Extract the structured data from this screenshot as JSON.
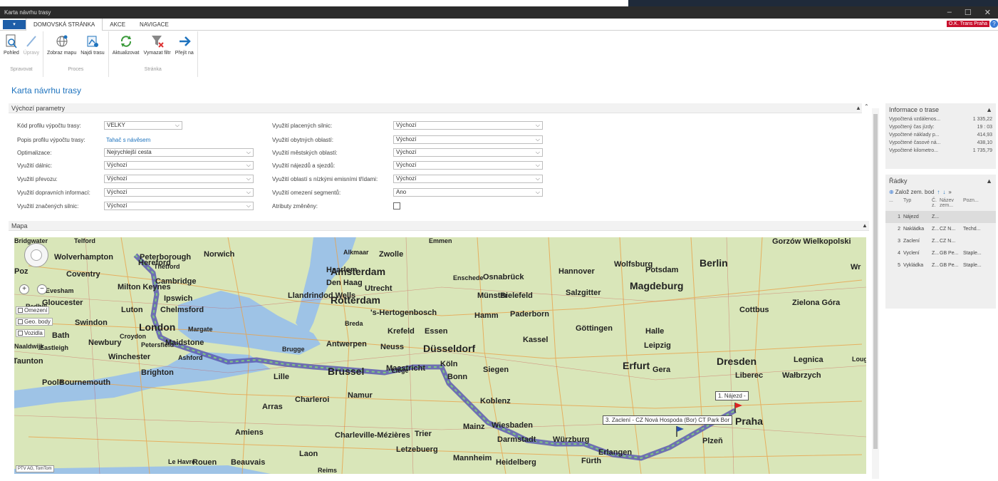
{
  "window": {
    "title": "Karta návrhu trasy",
    "minimize_icon": "minimize-icon",
    "maximize_glyph": "☐",
    "close_glyph": "✕"
  },
  "tabs": {
    "menu_glyph": "▾",
    "items": [
      "DOMOVSKÁ STRÁNKA",
      "AKCE",
      "NAVIGACE"
    ],
    "active": "DOMOVSKÁ STRÁNKA"
  },
  "company": "O.K. Trans Praha",
  "help_glyph": "?",
  "ribbon": {
    "groups": [
      {
        "label": "Spravovat",
        "buttons": [
          {
            "label": "Pohled",
            "icon": "view-icon"
          },
          {
            "label": "Úpravy",
            "icon": "edit-icon",
            "disabled": true
          }
        ]
      },
      {
        "label": "Proces",
        "buttons": [
          {
            "label": "Zobraz mapu",
            "icon": "globe-icon"
          },
          {
            "label": "Najdi trasu",
            "icon": "route-icon"
          }
        ]
      },
      {
        "label": "Stránka",
        "buttons": [
          {
            "label": "Aktualizovat",
            "icon": "refresh-icon"
          },
          {
            "label": "Vymazat filtr",
            "icon": "clear-filter-icon"
          },
          {
            "label": "Přejít na",
            "icon": "arrow-right-icon"
          }
        ]
      }
    ]
  },
  "page_title": "Karta návrhu trasy",
  "params": {
    "title": "Výchozí parametry",
    "left": [
      {
        "label": "Kód profilu výpočtu trasy:",
        "value": "VELKY",
        "type": "select"
      },
      {
        "label": "Popis profilu výpočtu trasy:",
        "value": "Tahač s návěsem",
        "type": "link"
      },
      {
        "label": "Optimalizace:",
        "value": "Nejrychlejší cesta",
        "type": "select"
      },
      {
        "label": "Využití dálnic:",
        "value": "Výchozí",
        "type": "select"
      },
      {
        "label": "Využití převozu:",
        "value": "Výchozí",
        "type": "select"
      },
      {
        "label": "Využití dopravních informací:",
        "value": "Výchozí",
        "type": "select"
      },
      {
        "label": "Využití značených silnic:",
        "value": "Výchozí",
        "type": "select"
      }
    ],
    "right": [
      {
        "label": "Využití placených silnic:",
        "value": "Výchozí",
        "type": "select"
      },
      {
        "label": "Využití obytných oblastí:",
        "value": "Výchozí",
        "type": "select"
      },
      {
        "label": "Využití městských oblastí:",
        "value": "Výchozí",
        "type": "select"
      },
      {
        "label": "Využití nájezdů a sjezdů:",
        "value": "Výchozí",
        "type": "select"
      },
      {
        "label": "Využití oblastí s nízkými emisními třídami:",
        "value": "Výchozí",
        "type": "select"
      },
      {
        "label": "Využití omezení segmentů:",
        "value": "Ano",
        "type": "select"
      },
      {
        "label": "Atributy změněny:",
        "value": "",
        "type": "checkbox"
      }
    ]
  },
  "map": {
    "title": "Mapa",
    "layers": [
      "Omezení",
      "Geo. body",
      "Vozidla"
    ],
    "copyright": "PTV AG, TomTom",
    "callouts": [
      "1. Nájezd -",
      "3. Zaclení - CZ Nová Hospoda (Bor) CT Park Bor"
    ],
    "cities": [
      {
        "n": "Wolverhampton",
        "s": "m"
      },
      {
        "n": "Peterborough",
        "s": "m"
      },
      {
        "n": "Norwich",
        "s": "m"
      },
      {
        "n": "Coventry",
        "s": "m"
      },
      {
        "n": "Cambridge",
        "s": "m"
      },
      {
        "n": "Milton Keynes",
        "s": "m"
      },
      {
        "n": "Ipswich",
        "s": "m"
      },
      {
        "n": "Gloucester",
        "s": "m"
      },
      {
        "n": "Luton",
        "s": "m"
      },
      {
        "n": "Chelmsford",
        "s": "m"
      },
      {
        "n": "Swindon",
        "s": "m"
      },
      {
        "n": "London",
        "s": "l"
      },
      {
        "n": "Maidstone",
        "s": "m"
      },
      {
        "n": "Newbury",
        "s": "m"
      },
      {
        "n": "Bath",
        "s": "m"
      },
      {
        "n": "Winchester",
        "s": "m"
      },
      {
        "n": "Taunton",
        "s": "m"
      },
      {
        "n": "Brighton",
        "s": "m"
      },
      {
        "n": "Poole",
        "s": "m"
      },
      {
        "n": "Bournemouth",
        "s": "m"
      },
      {
        "n": "Zwolle",
        "s": "m"
      },
      {
        "n": "Amsterdam",
        "s": "l"
      },
      {
        "n": "Haarlem",
        "s": "m"
      },
      {
        "n": "Den Haag",
        "s": "m"
      },
      {
        "n": "Utrecht",
        "s": "m"
      },
      {
        "n": "Rotterdam",
        "s": "l"
      },
      {
        "n": "'s-Hertogenbosch",
        "s": "m"
      },
      {
        "n": "Krefeld",
        "s": "m"
      },
      {
        "n": "Essen",
        "s": "m"
      },
      {
        "n": "Antwerpen",
        "s": "m"
      },
      {
        "n": "Neuss",
        "s": "m"
      },
      {
        "n": "Düsseldorf",
        "s": "l"
      },
      {
        "n": "Brussel",
        "s": "l"
      },
      {
        "n": "Köln",
        "s": "m"
      },
      {
        "n": "Bonn",
        "s": "m"
      },
      {
        "n": "Lille",
        "s": "m"
      },
      {
        "n": "Namur",
        "s": "m"
      },
      {
        "n": "Charleroi",
        "s": "m"
      },
      {
        "n": "Arras",
        "s": "m"
      },
      {
        "n": "Amiens",
        "s": "m"
      },
      {
        "n": "Charleville-Mézières",
        "s": "m"
      },
      {
        "n": "Rouen",
        "s": "m"
      },
      {
        "n": "Beauvais",
        "s": "m"
      },
      {
        "n": "Laon",
        "s": "m"
      },
      {
        "n": "Letzebuerg",
        "s": "m"
      },
      {
        "n": "Trier",
        "s": "m"
      },
      {
        "n": "Koblenz",
        "s": "m"
      },
      {
        "n": "Wiesbaden",
        "s": "m"
      },
      {
        "n": "Mainz",
        "s": "m"
      },
      {
        "n": "Darmstadt",
        "s": "m"
      },
      {
        "n": "Mannheim",
        "s": "m"
      },
      {
        "n": "Heidelberg",
        "s": "m"
      },
      {
        "n": "Würzburg",
        "s": "m"
      },
      {
        "n": "Erlangen",
        "s": "m"
      },
      {
        "n": "Fürth",
        "s": "m"
      },
      {
        "n": "Siegen",
        "s": "m"
      },
      {
        "n": "Osnabrück",
        "s": "m"
      },
      {
        "n": "Münster",
        "s": "m"
      },
      {
        "n": "Bielefeld",
        "s": "m"
      },
      {
        "n": "Hamm",
        "s": "m"
      },
      {
        "n": "Paderborn",
        "s": "m"
      },
      {
        "n": "Kassel",
        "s": "m"
      },
      {
        "n": "Göttingen",
        "s": "m"
      },
      {
        "n": "Hannover",
        "s": "m"
      },
      {
        "n": "Salzgitter",
        "s": "m"
      },
      {
        "n": "Wolfsburg",
        "s": "m"
      },
      {
        "n": "Magdeburg",
        "s": "l"
      },
      {
        "n": "Potsdam",
        "s": "m"
      },
      {
        "n": "Berlin",
        "s": "l"
      },
      {
        "n": "Halle",
        "s": "m"
      },
      {
        "n": "Leipzig",
        "s": "m"
      },
      {
        "n": "Erfurt",
        "s": "l"
      },
      {
        "n": "Gera",
        "s": "m"
      },
      {
        "n": "Dresden",
        "s": "l"
      },
      {
        "n": "Cottbus",
        "s": "m"
      },
      {
        "n": "Liberec",
        "s": "m"
      },
      {
        "n": "Wałbrzych",
        "s": "m"
      },
      {
        "n": "Legnica",
        "s": "m"
      },
      {
        "n": "Zielona Góra",
        "s": "m"
      },
      {
        "n": "Gorzów Wielkopolski",
        "s": "m"
      },
      {
        "n": "Praha",
        "s": "l"
      },
      {
        "n": "Plzeň",
        "s": "m"
      },
      {
        "n": "Enschede",
        "s": "s"
      },
      {
        "n": "Emmen",
        "s": "s"
      },
      {
        "n": "Alkmaar",
        "s": "s"
      },
      {
        "n": "Breda",
        "s": "s"
      },
      {
        "n": "Brugge",
        "s": "s"
      },
      {
        "n": "Maastricht",
        "s": "m"
      },
      {
        "n": "Liège",
        "s": "s"
      },
      {
        "n": "Reims",
        "s": "s"
      },
      {
        "n": "Le Havre",
        "s": "s"
      },
      {
        "n": "Croydon",
        "s": "s"
      },
      {
        "n": "Margate",
        "s": "s"
      },
      {
        "n": "Ashford",
        "s": "s"
      },
      {
        "n": "Thetford",
        "s": "s"
      },
      {
        "n": "Evesham",
        "s": "s"
      },
      {
        "n": "Eastleigh",
        "s": "s"
      },
      {
        "n": "Petersfield",
        "s": "s"
      },
      {
        "n": "Redhill",
        "s": "s"
      },
      {
        "n": "Hereford",
        "s": "m"
      },
      {
        "n": "Telford",
        "s": "s"
      },
      {
        "n": "Loughborough",
        "s": "s"
      },
      {
        "n": "Wr",
        "s": "m"
      },
      {
        "n": "Poz",
        "s": "m"
      },
      {
        "n": "Llandrindod Wells",
        "s": "m"
      },
      {
        "n": "Naaldwijk",
        "s": "s"
      },
      {
        "n": "Bridgwater",
        "s": "s"
      }
    ]
  },
  "route_info": {
    "title": "Informace o trase",
    "rows": [
      {
        "label": "Vypočtená vzdálenos...",
        "value": "1 335,22"
      },
      {
        "label": "Vypočtený čas jízdy:",
        "value": "19 : 03"
      },
      {
        "label": "Vypočtené náklady p...",
        "value": "414,93"
      },
      {
        "label": "Vypočtené časové ná...",
        "value": "438,10"
      },
      {
        "label": "Vypočtené kilometro...",
        "value": "1 735,79"
      }
    ]
  },
  "lines": {
    "title": "Řádky",
    "add_label": "Založ zem. bod",
    "columns": [
      "...",
      "Typ",
      "Č. z.",
      "Název zem...",
      "Pozn..."
    ],
    "rows": [
      {
        "n": "1",
        "typ": "Nájezd",
        "c": "Z...",
        "name": "",
        "poz": ""
      },
      {
        "n": "2",
        "typ": "Nakládka",
        "c": "Z...",
        "name": "CZ N...",
        "poz": "Techd..."
      },
      {
        "n": "3",
        "typ": "Zaclení",
        "c": "Z...",
        "name": "CZ N...",
        "poz": ""
      },
      {
        "n": "4",
        "typ": "Vyclení",
        "c": "Z...",
        "name": "GB Pe...",
        "poz": "Staple..."
      },
      {
        "n": "5",
        "typ": "Vykládka",
        "c": "Z...",
        "name": "GB Pe...",
        "poz": "Staple..."
      }
    ]
  },
  "colors": {
    "accent": "#1e73be",
    "route": "#6a6ab8",
    "map_bg": "#d9e6b9",
    "water": "#9ec3e6",
    "company_badge": "#c8102e"
  }
}
